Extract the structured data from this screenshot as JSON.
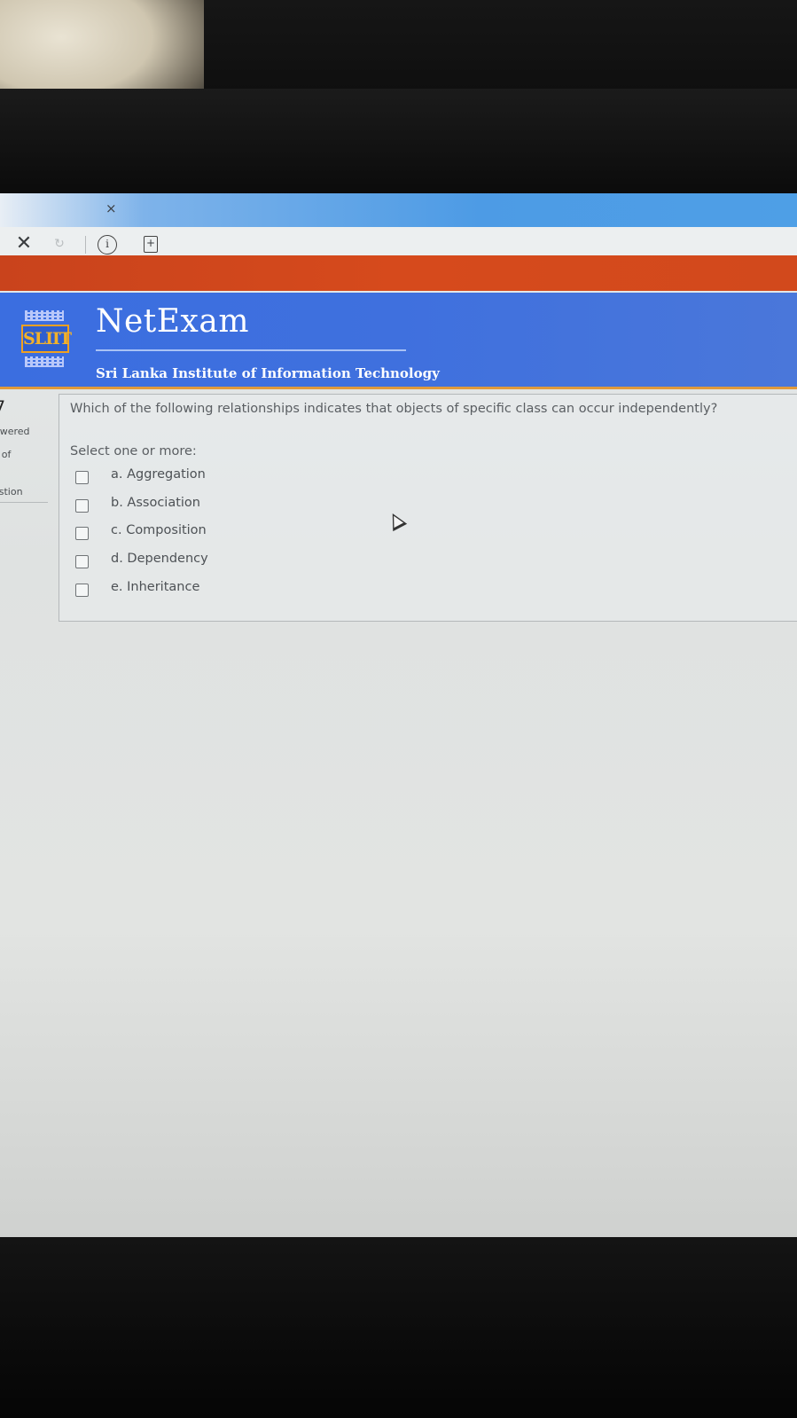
{
  "browser": {
    "tab_close": "×",
    "toolbar": {
      "close_glyph": "✕",
      "refresh_glyph": "↻",
      "info_glyph": "i",
      "add_page_glyph": "+"
    }
  },
  "header": {
    "title": "NetExam",
    "subtitle": "Sri Lanka Institute of Information Technology",
    "logo_text": "SLIIT",
    "colors": {
      "orange_bar": "#d64a1c",
      "blue_header": "#3f70de",
      "accent_line": "#e09a3c"
    }
  },
  "question_nav": {
    "number": "7",
    "status": "swered",
    "mark": "t of",
    "flag": "estion"
  },
  "question": {
    "text": "Which of the following relationships indicates that objects of specific class can occur independently?",
    "prompt": "Select one or more:",
    "options": [
      {
        "label": "a. Aggregation",
        "checked": false
      },
      {
        "label": "b. Association",
        "checked": false
      },
      {
        "label": "c. Composition",
        "checked": false
      },
      {
        "label": "d. Dependency",
        "checked": false
      },
      {
        "label": "e. Inheritance",
        "checked": false
      }
    ]
  }
}
